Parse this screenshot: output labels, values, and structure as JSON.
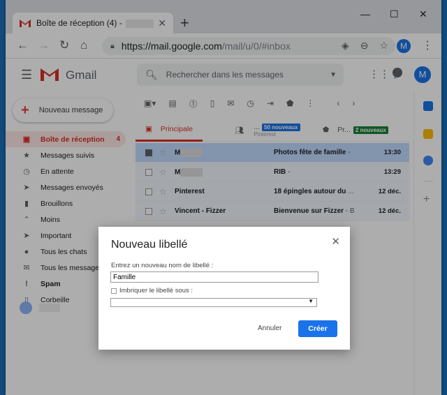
{
  "browser": {
    "tab_title": "Boîte de réception (4) -",
    "tab_close": "✕",
    "new_tab": "+",
    "win_minimize": "—",
    "win_maximize": "☐",
    "win_close": "✕",
    "url_main": "https://mail.google.com",
    "url_rest": "/mail/u/0/#inbox",
    "profile_initial": "M"
  },
  "gmail": {
    "brand": "Gmail",
    "search_placeholder": "Rechercher dans les messages",
    "avatar_initial": "M",
    "compose_label": "Nouveau message",
    "sidebar": [
      {
        "label": "Boîte de réception",
        "count": "4",
        "icon": "inbox-icon",
        "glyph": "▣",
        "active": true
      },
      {
        "label": "Messages suivis",
        "count": "",
        "icon": "star-icon",
        "glyph": "★"
      },
      {
        "label": "En attente",
        "count": "",
        "icon": "clock-icon",
        "glyph": "◷"
      },
      {
        "label": "Messages envoyés",
        "count": "",
        "icon": "send-icon",
        "glyph": "➤"
      },
      {
        "label": "Brouillons",
        "count": "",
        "icon": "draft-icon",
        "glyph": "▮"
      },
      {
        "label": "Moins",
        "count": "",
        "icon": "chevron-up-icon",
        "glyph": "⌃"
      },
      {
        "label": "Important",
        "count": "",
        "icon": "important-icon",
        "glyph": "➤"
      },
      {
        "label": "Tous les chats",
        "count": "",
        "icon": "chat-icon",
        "glyph": "●"
      },
      {
        "label": "Tous les messages",
        "count": "",
        "icon": "mail-icon",
        "glyph": "✉"
      },
      {
        "label": "Spam",
        "count": "",
        "icon": "spam-icon",
        "glyph": "!",
        "bold": true
      },
      {
        "label": "Corbeille",
        "count": "",
        "icon": "trash-icon",
        "glyph": "▯"
      }
    ],
    "tabs": {
      "primary": "Principale",
      "social_label": "...",
      "social_badge": "50 nouveaux",
      "social_sub": "Pinterest",
      "promo_label": "Pr...",
      "promo_badge": "2 nouveaux"
    },
    "emails": [
      {
        "sender": "M",
        "subject": "Photos fête de famille",
        "snippet": " -",
        "date": "13:30",
        "selected": true
      },
      {
        "sender": "M",
        "subject": "RIB",
        "snippet": " -",
        "date": "13:29"
      },
      {
        "sender": "Pinterest",
        "subject": "18 épingles autour du",
        "snippet": " ...",
        "date": "12 déc."
      },
      {
        "sender": "Vincent - Fizzer",
        "subject": "Bienvenue sur Fizzer",
        "snippet": " - B",
        "date": "12 déc."
      }
    ],
    "colors": {
      "accent_red": "#d93025",
      "primary_blue": "#1a73e8",
      "social_badge": "#1a73e8",
      "promo_badge": "#188038"
    }
  },
  "dialog": {
    "title": "Nouveau libellé",
    "close": "✕",
    "name_label": "Entrez un nouveau nom de libellé :",
    "name_value": "Famille",
    "nest_label": "Imbriquer le libellé sous :",
    "select_value": "",
    "cancel_label": "Annuler",
    "create_label": "Créer"
  }
}
